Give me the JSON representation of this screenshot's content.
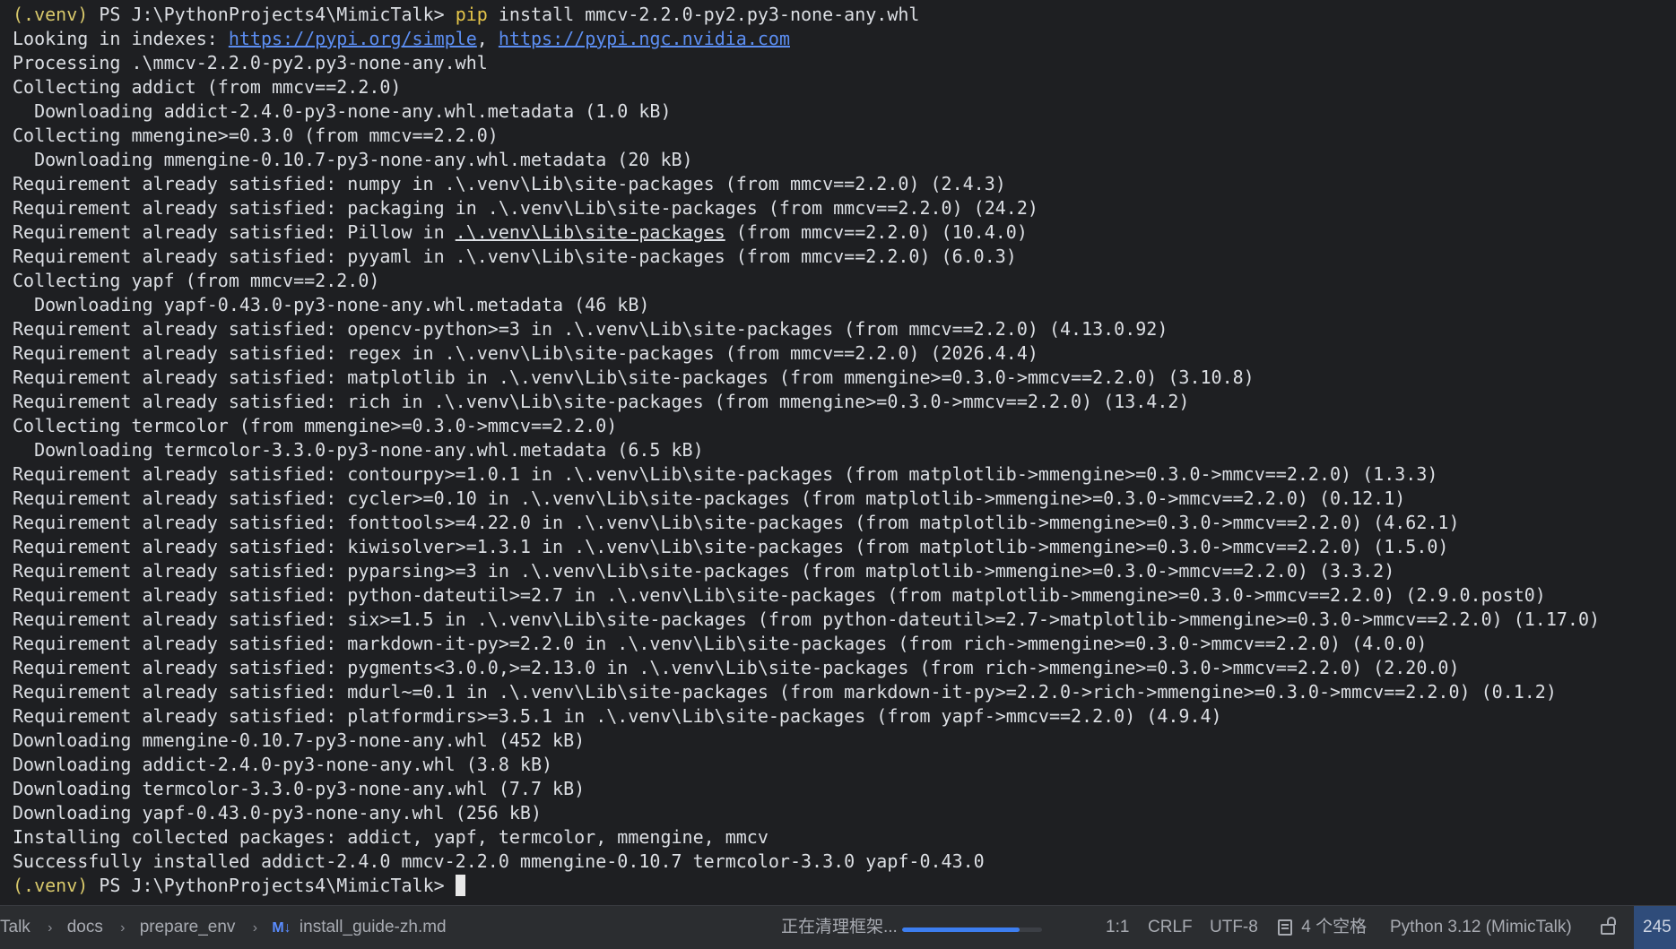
{
  "terminal": {
    "lines": [
      [
        {
          "t": "(.venv)",
          "c": "venv"
        },
        {
          "t": " PS J:\\PythonProjects4\\MimicTalk> "
        },
        {
          "t": "pip",
          "c": "cmd"
        },
        {
          "t": " install mmcv-2.2.0-py2.py3-none-any.whl"
        }
      ],
      [
        {
          "t": "Looking in indexes: "
        },
        {
          "t": "https://pypi.org/simple",
          "c": "link"
        },
        {
          "t": ", "
        },
        {
          "t": "https://pypi.ngc.nvidia.com",
          "c": "link"
        }
      ],
      [
        {
          "t": "Processing .\\mmcv-2.2.0-py2.py3-none-any.whl"
        }
      ],
      [
        {
          "t": "Collecting addict (from mmcv==2.2.0)"
        }
      ],
      [
        {
          "t": "  Downloading addict-2.4.0-py3-none-any.whl.metadata (1.0 kB)"
        }
      ],
      [
        {
          "t": "Collecting mmengine>=0.3.0 (from mmcv==2.2.0)"
        }
      ],
      [
        {
          "t": "  Downloading mmengine-0.10.7-py3-none-any.whl.metadata (20 kB)"
        }
      ],
      [
        {
          "t": "Requirement already satisfied: numpy in .\\.venv\\Lib\\site-packages (from mmcv==2.2.0) (2.4.3)"
        }
      ],
      [
        {
          "t": "Requirement already satisfied: packaging in .\\.venv\\Lib\\site-packages (from mmcv==2.2.0) (24.2)"
        }
      ],
      [
        {
          "t": "Requirement already satisfied: Pillow in "
        },
        {
          "t": ".\\.venv\\Lib\\site-packages",
          "c": "uline"
        },
        {
          "t": " (from mmcv==2.2.0) (10.4.0)"
        }
      ],
      [
        {
          "t": "Requirement already satisfied: pyyaml in .\\.venv\\Lib\\site-packages (from mmcv==2.2.0) (6.0.3)"
        }
      ],
      [
        {
          "t": "Collecting yapf (from mmcv==2.2.0)"
        }
      ],
      [
        {
          "t": "  Downloading yapf-0.43.0-py3-none-any.whl.metadata (46 kB)"
        }
      ],
      [
        {
          "t": "Requirement already satisfied: opencv-python>=3 in .\\.venv\\Lib\\site-packages (from mmcv==2.2.0) (4.13.0.92)"
        }
      ],
      [
        {
          "t": "Requirement already satisfied: regex in .\\.venv\\Lib\\site-packages (from mmcv==2.2.0) (2026.4.4)"
        }
      ],
      [
        {
          "t": "Requirement already satisfied: matplotlib in .\\.venv\\Lib\\site-packages (from mmengine>=0.3.0->mmcv==2.2.0) (3.10.8)"
        }
      ],
      [
        {
          "t": "Requirement already satisfied: rich in .\\.venv\\Lib\\site-packages (from mmengine>=0.3.0->mmcv==2.2.0) (13.4.2)"
        }
      ],
      [
        {
          "t": "Collecting termcolor (from mmengine>=0.3.0->mmcv==2.2.0)"
        }
      ],
      [
        {
          "t": "  Downloading termcolor-3.3.0-py3-none-any.whl.metadata (6.5 kB)"
        }
      ],
      [
        {
          "t": "Requirement already satisfied: contourpy>=1.0.1 in .\\.venv\\Lib\\site-packages (from matplotlib->mmengine>=0.3.0->mmcv==2.2.0) (1.3.3)"
        }
      ],
      [
        {
          "t": "Requirement already satisfied: cycler>=0.10 in .\\.venv\\Lib\\site-packages (from matplotlib->mmengine>=0.3.0->mmcv==2.2.0) (0.12.1)"
        }
      ],
      [
        {
          "t": "Requirement already satisfied: fonttools>=4.22.0 in .\\.venv\\Lib\\site-packages (from matplotlib->mmengine>=0.3.0->mmcv==2.2.0) (4.62.1)"
        }
      ],
      [
        {
          "t": "Requirement already satisfied: kiwisolver>=1.3.1 in .\\.venv\\Lib\\site-packages (from matplotlib->mmengine>=0.3.0->mmcv==2.2.0) (1.5.0)"
        }
      ],
      [
        {
          "t": "Requirement already satisfied: pyparsing>=3 in .\\.venv\\Lib\\site-packages (from matplotlib->mmengine>=0.3.0->mmcv==2.2.0) (3.3.2)"
        }
      ],
      [
        {
          "t": "Requirement already satisfied: python-dateutil>=2.7 in .\\.venv\\Lib\\site-packages (from matplotlib->mmengine>=0.3.0->mmcv==2.2.0) (2.9.0.post0)"
        }
      ],
      [
        {
          "t": "Requirement already satisfied: six>=1.5 in .\\.venv\\Lib\\site-packages (from python-dateutil>=2.7->matplotlib->mmengine>=0.3.0->mmcv==2.2.0) (1.17.0)"
        }
      ],
      [
        {
          "t": "Requirement already satisfied: markdown-it-py>=2.2.0 in .\\.venv\\Lib\\site-packages (from rich->mmengine>=0.3.0->mmcv==2.2.0) (4.0.0)"
        }
      ],
      [
        {
          "t": "Requirement already satisfied: pygments<3.0.0,>=2.13.0 in .\\.venv\\Lib\\site-packages (from rich->mmengine>=0.3.0->mmcv==2.2.0) (2.20.0)"
        }
      ],
      [
        {
          "t": "Requirement already satisfied: mdurl~=0.1 in .\\.venv\\Lib\\site-packages (from markdown-it-py>=2.2.0->rich->mmengine>=0.3.0->mmcv==2.2.0) (0.1.2)"
        }
      ],
      [
        {
          "t": "Requirement already satisfied: platformdirs>=3.5.1 in .\\.venv\\Lib\\site-packages (from yapf->mmcv==2.2.0) (4.9.4)"
        }
      ],
      [
        {
          "t": "Downloading mmengine-0.10.7-py3-none-any.whl (452 kB)"
        }
      ],
      [
        {
          "t": "Downloading addict-2.4.0-py3-none-any.whl (3.8 kB)"
        }
      ],
      [
        {
          "t": "Downloading termcolor-3.3.0-py3-none-any.whl (7.7 kB)"
        }
      ],
      [
        {
          "t": "Downloading yapf-0.43.0-py3-none-any.whl (256 kB)"
        }
      ],
      [
        {
          "t": "Installing collected packages: addict, yapf, termcolor, mmengine, mmcv"
        }
      ],
      [
        {
          "t": "Successfully installed addict-2.4.0 mmcv-2.2.0 mmengine-0.10.7 termcolor-3.3.0 yapf-0.43.0"
        }
      ],
      [
        {
          "t": "(.venv)",
          "c": "venv"
        },
        {
          "t": " PS J:\\PythonProjects4\\MimicTalk> "
        }
      ]
    ]
  },
  "statusbar": {
    "breadcrumb": {
      "items": [
        "Talk",
        "docs",
        "prepare_env",
        "install_guide-zh.md"
      ],
      "md_icon": "M↓",
      "separator": "›"
    },
    "task_label": "正在清理框架...",
    "task_progress": 0.84,
    "position": "1:1",
    "line_ending": "CRLF",
    "encoding": "UTF-8",
    "indent": "4 个空格",
    "interpreter": "Python 3.12 (MimicTalk)",
    "end_badge": "245"
  },
  "colors": {
    "background": "#1e1f22",
    "text": "#dcdfe4",
    "venv": "#d8c86b",
    "command": "#e5c54a",
    "link": "#5c8ef2",
    "statusbar": "#2b2d30",
    "progress": "#3d7ef0"
  },
  "icons": {
    "markdown_file": "markdown-icon",
    "indent": "indent-columns-icon",
    "readonly": "lock-icon"
  }
}
